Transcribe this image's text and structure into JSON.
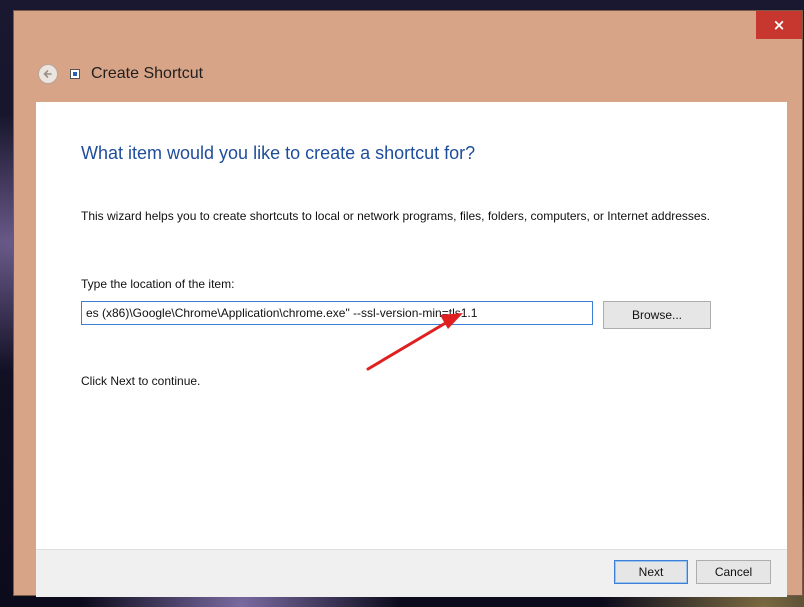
{
  "window": {
    "title": "Create Shortcut",
    "close_glyph": "×",
    "icons": {
      "back": "back-arrow-icon",
      "app": "shortcut-icon",
      "close": "close-icon"
    }
  },
  "content": {
    "heading": "What item would you like to create a shortcut for?",
    "description": "This wizard helps you to create shortcuts to local or network programs, files, folders, computers, or Internet addresses.",
    "location_label": "Type the location of the item:",
    "location_value": "es (x86)\\Google\\Chrome\\Application\\chrome.exe\" --ssl-version-min=tls1.1",
    "browse_label": "Browse...",
    "hint": "Click Next to continue."
  },
  "footer": {
    "next_label": "Next",
    "cancel_label": "Cancel"
  },
  "annotation": {
    "arrow_color": "#e02020"
  },
  "colors": {
    "frame": "#d8a487",
    "close_button": "#c7362f",
    "heading": "#1e4e9b",
    "focus_border": "#3c7fd6"
  }
}
